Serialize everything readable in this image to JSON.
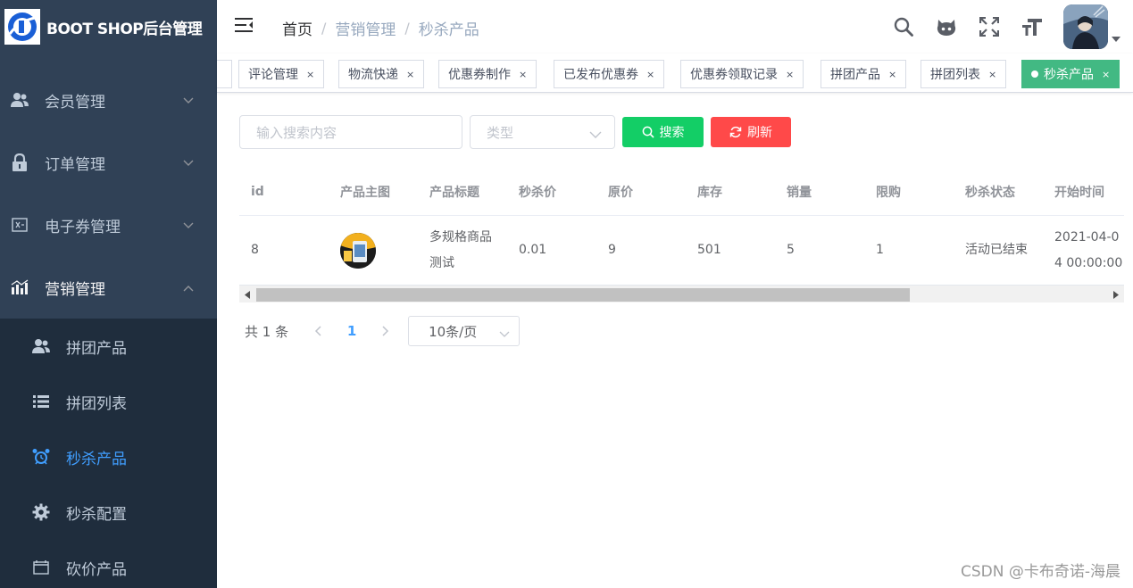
{
  "app": {
    "brand": "BOOT SHOP后台管理",
    "logo_letter": "D",
    "accent": "#409eff",
    "sidebar_bg": "#304156",
    "submenu_bg": "#1f2d3d"
  },
  "sidebar": {
    "menus": [
      {
        "label": "会员管理",
        "icon": "users-icon",
        "state": "collapsed"
      },
      {
        "label": "订单管理",
        "icon": "lock-icon",
        "state": "collapsed"
      },
      {
        "label": "电子券管理",
        "icon": "coupon-icon",
        "state": "collapsed"
      },
      {
        "label": "营销管理",
        "icon": "chart-icon",
        "state": "expanded"
      }
    ],
    "submenu": [
      {
        "label": "拼团产品",
        "icon": "users-icon",
        "active": false
      },
      {
        "label": "拼团列表",
        "icon": "list-icon",
        "active": false
      },
      {
        "label": "秒杀产品",
        "icon": "alarm-clock-icon",
        "active": true
      },
      {
        "label": "秒杀配置",
        "icon": "gear-icon",
        "active": false
      },
      {
        "label": "砍价产品",
        "icon": "window-icon",
        "active": false
      }
    ]
  },
  "navbar": {
    "breadcrumb": [
      "首页",
      "营销管理",
      "秒杀产品"
    ],
    "separator": "/",
    "icons": [
      "search-icon",
      "github-icon",
      "fullscreen-icon",
      "font-size-icon"
    ]
  },
  "tags": {
    "items": [
      {
        "label": "评论管理",
        "active": false
      },
      {
        "label": "物流快递",
        "active": false
      },
      {
        "label": "优惠券制作",
        "active": false
      },
      {
        "label": "已发布优惠券",
        "active": false
      },
      {
        "label": "优惠券领取记录",
        "active": false
      },
      {
        "label": "拼团产品",
        "active": false
      },
      {
        "label": "拼团列表",
        "active": false
      },
      {
        "label": "秒杀产品",
        "active": true
      }
    ],
    "close": "×",
    "active_color": "#42b983"
  },
  "filters": {
    "search_placeholder": "输入搜索内容",
    "type_placeholder": "类型",
    "search_button": "搜索",
    "refresh_button": "刷新",
    "search_color": "#13ce66",
    "refresh_color": "#ff4949"
  },
  "table": {
    "columns": [
      "id",
      "产品主图",
      "产品标题",
      "秒杀价",
      "原价",
      "库存",
      "销量",
      "限购",
      "秒杀状态",
      "开始时间"
    ],
    "rows": [
      {
        "id": "8",
        "title": "多规格商品测试",
        "seckill_price": "0.01",
        "original_price": "9",
        "stock": "501",
        "sales": "5",
        "limit": "1",
        "status": "活动已结束",
        "start_time": "2021-04-04 00:00:00"
      }
    ]
  },
  "pagination": {
    "total": "共 1 条",
    "current_page": "1",
    "page_size": "10条/页"
  },
  "watermark": "CSDN @卡布奇诺-海晨"
}
